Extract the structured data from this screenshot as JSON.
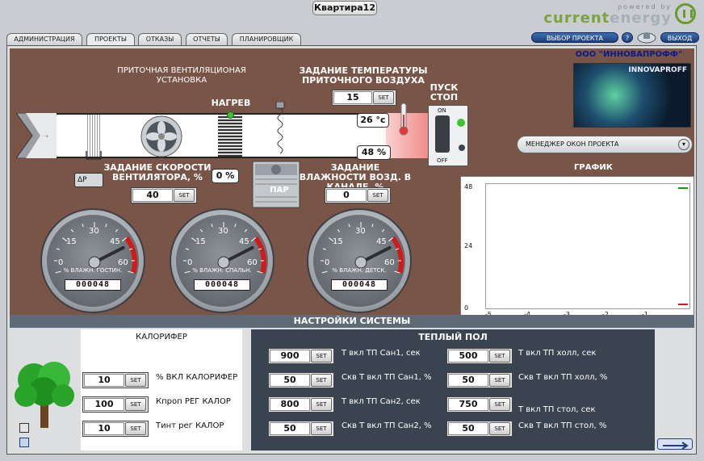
{
  "app_title": "Квартира12",
  "logo": {
    "powered": "powered by",
    "current": "current",
    "energy": "energy"
  },
  "tabs": [
    "АДМИНИСТРАЦИЯ",
    "ПРОЕКТЫ",
    "ОТКАЗЫ",
    "ОТЧЕТЫ",
    "ПЛАНИРОВЩИК"
  ],
  "top_buttons": {
    "project_select": "ВЫБОР ПРОЕКТА",
    "help": "?",
    "exit": "ВЫХОД"
  },
  "company": "ООО \"ИННОВАПРОФФ\"",
  "company_logo_text": "INNOVAPROFF",
  "window_manager": "МЕНЕДЖЕР ОКОН ПРОЕКТА",
  "vent": {
    "title": "ПРИТОЧНАЯ ВЕНТИЛЯЦИОНАЯ УСТАНОВКА",
    "heat_label": "НАГРЕВ",
    "heat_value": "0 %",
    "temp_setpoint_label": "ЗАДАНИЕ ТЕМПЕРАТУРЫ ПРИТОЧНОГО ВОЗДУХА",
    "temp_setpoint": "15",
    "temp_reading": "26 °c",
    "humidity_reading": "48 %",
    "fan_speed_label": "ЗАДАНИЕ СКОРОСТИ ВЕНТИЛЯТОРА, %",
    "fan_speed": "40",
    "humidity_setpoint_label": "ЗАДАНИЕ ВЛАЖНОСТИ ВОЗД. В КАНАЛЕ, %",
    "humidity_setpoint": "0",
    "steam_label": "ПАР",
    "dp_label": "ΔP",
    "start_stop_label": "ПУСК СТОП",
    "switch_on": "ON",
    "switch_off": "OFF"
  },
  "set_label": "SET",
  "gauges": [
    {
      "label": "% ВЛАЖН. ГОСТИН.",
      "counter": "000048",
      "value": 48
    },
    {
      "label": "% ВЛАЖН. СПАЛЬН.",
      "counter": "000048",
      "value": 48
    },
    {
      "label": "% ВЛАЖН. ДЕТСК.",
      "counter": "000048",
      "value": 48
    }
  ],
  "gauge_ticks": [
    "0",
    "15",
    "30",
    "45",
    "60"
  ],
  "graph": {
    "title": "ГРАФИК",
    "y_ticks": [
      "48",
      "24",
      "0"
    ],
    "x_ticks": [
      "-5",
      "-4",
      "-3",
      "-2",
      "-1"
    ]
  },
  "settings": {
    "title": "НАСТРОЙКИ СИСТЕМЫ",
    "calorifer": {
      "title": "КАЛОРИФЕР",
      "rows": [
        {
          "value": "10",
          "label": "% ВКЛ КАЛОРИФЕР"
        },
        {
          "value": "100",
          "label": "Кпроп РЕГ КАЛОР"
        },
        {
          "value": "10",
          "label": "Тинт рег КАЛОР"
        }
      ]
    },
    "warm_floor": {
      "title": "ТЕПЛЫЙ ПОЛ",
      "left": [
        {
          "value": "900",
          "label": "Т вкл ТП Сан1, сек"
        },
        {
          "value": "50",
          "label": "Скв Т вкл ТП Сан1, %"
        },
        {
          "value": "800",
          "label": "Т вкл ТП Сан2, сек"
        },
        {
          "value": "50",
          "label": "Скв Т вкл ТП Сан2, %"
        }
      ],
      "right": [
        {
          "value": "500",
          "label": "Т вкл ТП холл, сек"
        },
        {
          "value": "50",
          "label": "Скв Т вкл ТП холл, %"
        },
        {
          "value": "750",
          "label": "Т вкл ТП стол, сек"
        },
        {
          "value": "50",
          "label": "Скв Т вкл ТП стол, %"
        }
      ]
    }
  },
  "colors": {
    "brown": "#795548",
    "panel_dark": "#3a4350",
    "accent_blue": "#1d3f7a",
    "status_green": "#39c632"
  }
}
